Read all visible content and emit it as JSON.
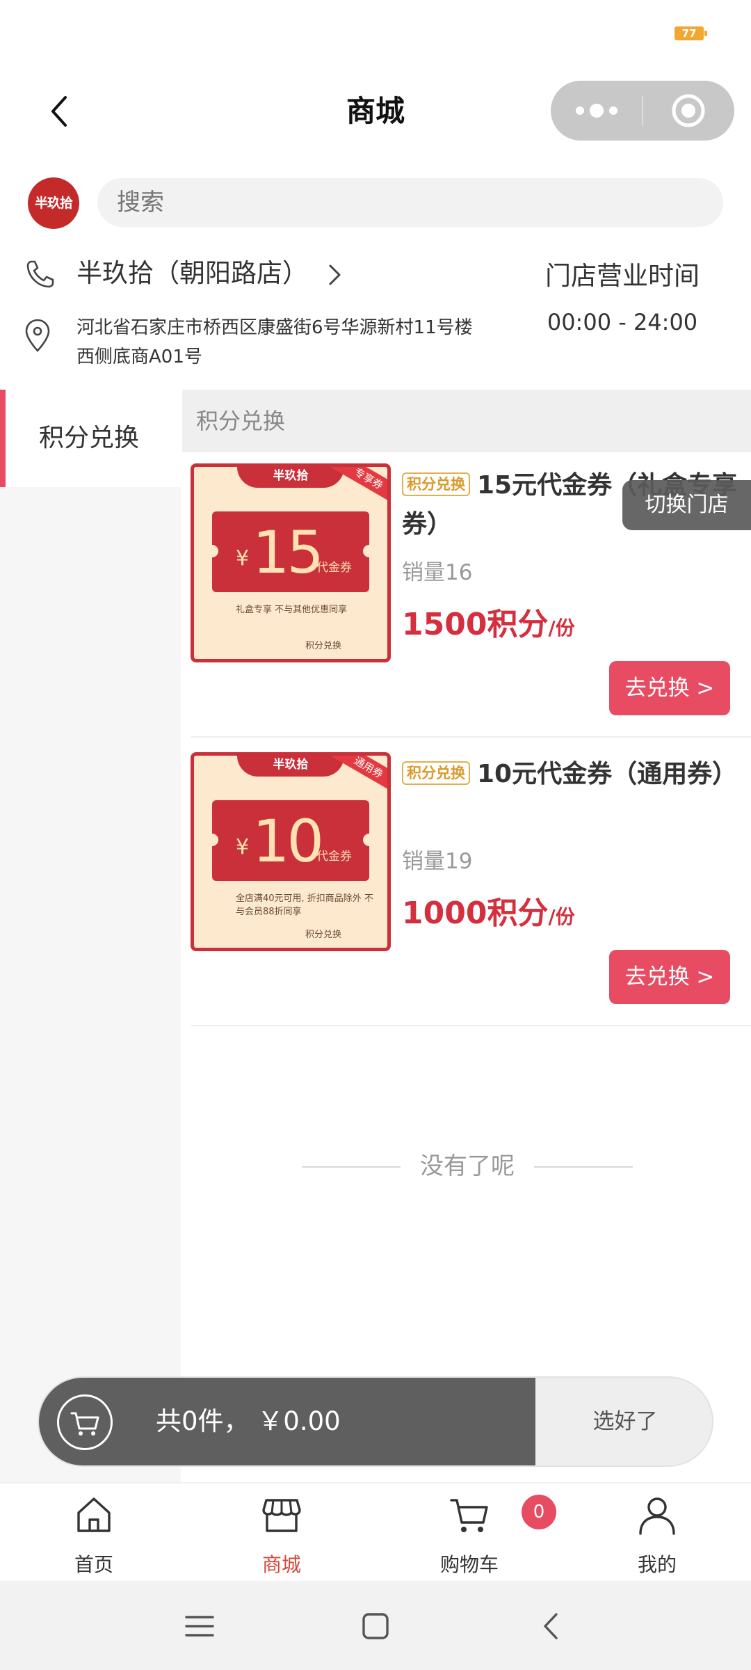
{
  "status": {
    "battery": "77"
  },
  "header": {
    "title": "商城"
  },
  "search": {
    "placeholder": "搜索",
    "logo_text": "半玖拾"
  },
  "store": {
    "name": "半玖拾（朝阳路店）",
    "address": "河北省石家庄市桥西区康盛街6号华源新村11号楼西侧底商A01号",
    "hours_title": "门店营业时间",
    "hours_value": "00:00 - 24:00"
  },
  "categories": [
    {
      "label": "积分兑换",
      "active": true
    }
  ],
  "section_title": "积分兑换",
  "switch_store_label": "切换门店",
  "products": [
    {
      "tag": "积分兑换",
      "title": "15元代金券（礼盒专享券）",
      "sales": "销量16",
      "price_points": "1500积分",
      "price_unit": "/份",
      "button": "去兑换 >",
      "coupon": {
        "brand": "半玖拾",
        "currency": "¥",
        "amount": "15",
        "unit": "代金券",
        "ribbon": "专享券",
        "note": "礼盒专享 不与其他优惠同享",
        "stamp": "积分兑换"
      }
    },
    {
      "tag": "积分兑换",
      "title": "10元代金券（通用券）",
      "sales": "销量19",
      "price_points": "1000积分",
      "price_unit": "/份",
      "button": "去兑换 >",
      "coupon": {
        "brand": "半玖拾",
        "currency": "¥",
        "amount": "10",
        "unit": "代金券",
        "ribbon": "通用券",
        "note": "全店满40元可用, 折扣商品除外 不与会员88折同享",
        "stamp": "积分兑换"
      }
    }
  ],
  "end_text": "没有了呢",
  "cart": {
    "total": "共0件， ￥0.00",
    "confirm": "选好了"
  },
  "tabbar": {
    "items": [
      {
        "label": "首页",
        "icon": "home-icon"
      },
      {
        "label": "商城",
        "icon": "store-icon",
        "active": true
      },
      {
        "label": "购物车",
        "icon": "cart-icon",
        "badge": "0"
      },
      {
        "label": "我的",
        "icon": "user-icon"
      }
    ]
  },
  "colors": {
    "accent": "#e84c63",
    "price": "#d42f3e",
    "tag": "#e0b04d",
    "active_tab": "#d4473a"
  }
}
